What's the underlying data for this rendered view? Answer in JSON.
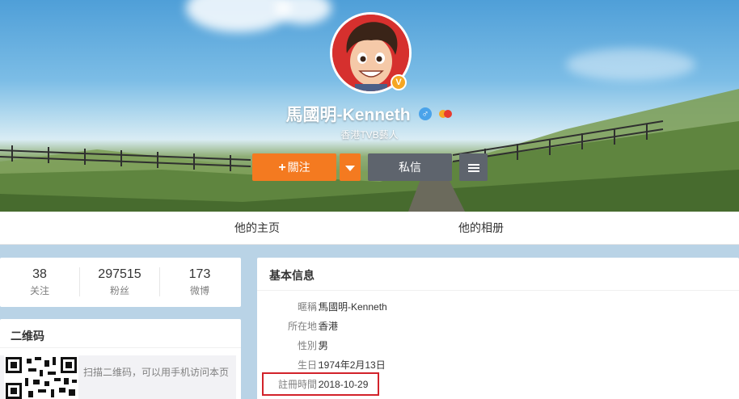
{
  "profile": {
    "name": "馬國明-Kenneth",
    "bio": "香港TVB藝人",
    "verified_badge": "V",
    "gender_icon": "♂",
    "colors": {
      "follow": "#f47a20",
      "message": "#5e646d",
      "highlight_border": "#d2222a"
    }
  },
  "actions": {
    "follow_label": "關注",
    "follow_plus": "+",
    "message_label": "私信"
  },
  "tabs": [
    {
      "label": "他的主页"
    },
    {
      "label": "他的相册"
    }
  ],
  "stats": [
    {
      "value": "38",
      "label": "关注"
    },
    {
      "value": "297515",
      "label": "粉丝"
    },
    {
      "value": "173",
      "label": "微博"
    }
  ],
  "qr": {
    "title": "二维码",
    "text": "扫描二维码，可以用手机访问本页"
  },
  "basic_info": {
    "title": "基本信息",
    "rows": [
      {
        "label": "暱稱：",
        "value": "馬國明-Kenneth"
      },
      {
        "label": "所在地：",
        "value": "香港"
      },
      {
        "label": "性別：",
        "value": "男"
      },
      {
        "label": "生日：",
        "value": "1974年2月13日"
      },
      {
        "label": "註冊時間：",
        "value": "2018-10-29"
      }
    ]
  }
}
